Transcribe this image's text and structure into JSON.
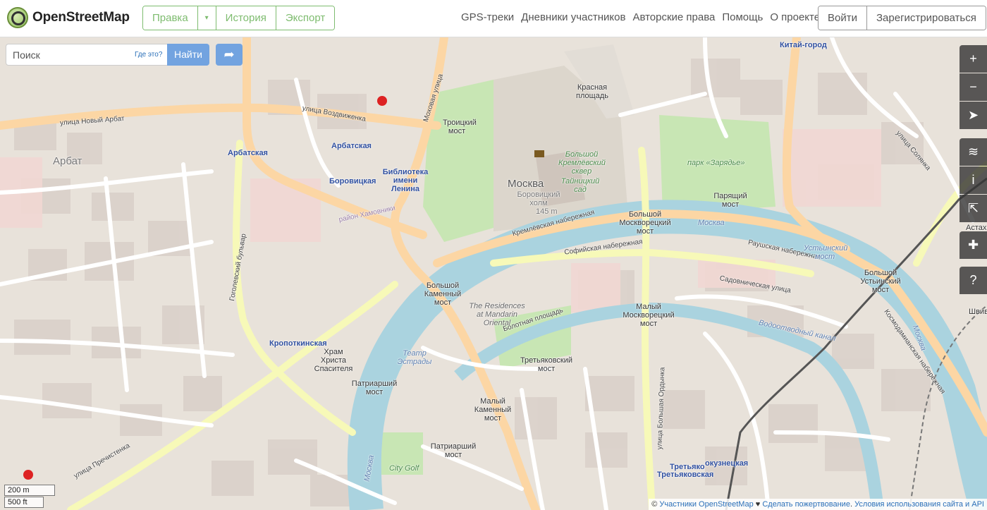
{
  "header": {
    "logo_text": "OpenStreetMap",
    "edit_group": {
      "edit": "Правка",
      "caret": "▾",
      "history": "История",
      "export": "Экспорт"
    },
    "nav": [
      "GPS-треки",
      "Дневники участников",
      "Авторские права",
      "Помощь",
      "О проекте"
    ],
    "login": "Войти",
    "signup": "Зарегистрироваться"
  },
  "search": {
    "placeholder": "Поиск",
    "where": "Где это?",
    "submit": "Найти",
    "directions_icon": "directions-arrow-icon"
  },
  "controls": [
    {
      "name": "zoom-in-button",
      "glyph": "+"
    },
    {
      "name": "zoom-out-button",
      "glyph": "−"
    },
    {
      "name": "locate-button",
      "glyph": "➤"
    },
    {
      "name": "layers-button",
      "glyph": "≋"
    },
    {
      "name": "legend-button",
      "glyph": "i"
    },
    {
      "name": "share-button",
      "glyph": "⇱"
    },
    {
      "name": "add-note-button",
      "glyph": "✚"
    },
    {
      "name": "query-features-button",
      "glyph": "?"
    }
  ],
  "scale": {
    "metric": "200 m",
    "imperial": "500 ft"
  },
  "attribution": {
    "prefix": "© ",
    "contributors": "Участники OpenStreetMap",
    "heart": " ♥ ",
    "donate": "Сделать пожертвование",
    "sep": ". ",
    "terms": "Условия использования сайта и API"
  },
  "map": {
    "labels": {
      "kitai_gorod": "Китай-город",
      "krasnaya": "Красная площадь",
      "arbat_district": "Арбат",
      "vozdvizhenka": "улица Воздвиженка",
      "novy_arbat": "улица Новый Арбат",
      "mokhovaya": "Моховая улица",
      "troitsky": "Троицкий мост",
      "arbatskaya1": "Арбатская",
      "arbatskaya2": "Арбатская",
      "biblioteka": "Библиотека имени Ленина",
      "borovitskaya": "Боровицкая",
      "moskva": "Москва",
      "borovitsky_holm": "Боровицкий холм",
      "holm_height": "145 m",
      "kreml_skver": "Большой Кремлёвский сквер",
      "tainitsky": "Тайницкий сад",
      "zaryadye": "парк «Зарядье»",
      "paryashchy": "Парящий мост",
      "bolshoy_moskvoretsky": "Большой Москворецкий мост",
      "kremlyovskaya_nab": "Кремлёвская набережная",
      "sofiyskaya_nab": "Софийская набережная",
      "raushskaya_nab": "Раушская набережная",
      "ustinsky_most_water": "Устьинский мост",
      "bolshoy_ustinsky": "Большой Устьинский мост",
      "sadovnicheskaya": "Садовническая улица",
      "bolshoy_kamenny": "Большой Каменный мост",
      "residences": "The Residences at Mandarin Oriental",
      "bolotnaya": "Болотная площадь",
      "maly_moskvoretsky": "Малый Москворецкий мост",
      "vodootvodny": "Водоотводный канал",
      "kropotkinskaya": "Кропоткинская",
      "hram": "Храм Христа Спасителя",
      "teatr": "Театр Эстрады",
      "tretyakovsky": "Третьяковский мост",
      "patriarshy1": "Патриарший мост",
      "patriarshy2": "Патриарший мост",
      "maly_kamenny": "Малый Каменный мост",
      "gogolevsky": "Гоголевский бульвар",
      "prechistenka": "улица Пречистенка",
      "city_golf": "City Golf",
      "tretyakovskaya": "Третьяковская",
      "novokuznetskaya": "окузнецкая",
      "tretyako": "Третьяко",
      "moskva_river1": "Москва",
      "moskva_river2": "Москва",
      "moskva_river3": "Москва",
      "bolshaya_ordynka": "улица Большая Ордынка",
      "kosmodamianskaya": "Космодамианская набережная",
      "solyanka": "улица Солянка",
      "shivaya": "Швивая",
      "astakh": "Астах",
      "raion_khamovniki": "район Хамовники"
    }
  }
}
